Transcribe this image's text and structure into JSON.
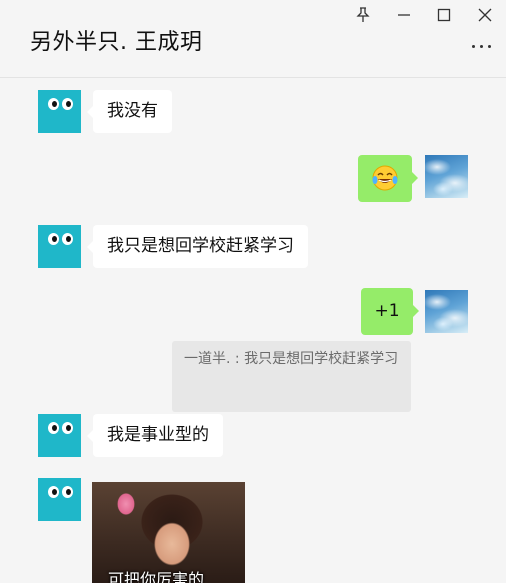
{
  "window": {
    "title": "另外半只. 王成玥",
    "controls": {
      "pin": "pin-icon",
      "minimize": "minimize-icon",
      "maximize": "maximize-icon",
      "close": "close-icon"
    },
    "more": "more-icon"
  },
  "messages": [
    {
      "side": "in",
      "text": "我没有"
    },
    {
      "side": "out",
      "emoji": "face-with-tears-of-joy"
    },
    {
      "side": "in",
      "text": "我只是想回学校赶紧学习"
    },
    {
      "side": "out",
      "text": "+1",
      "quote": "一道半. : 我只是想回学校赶紧学习"
    },
    {
      "side": "in",
      "text": "我是事业型的"
    },
    {
      "side": "in",
      "sticker_caption": "可把你厉害的"
    }
  ],
  "colors": {
    "out_bubble": "#95ec69",
    "in_bubble": "#ffffff",
    "bot_avatar": "#1fb7c9",
    "background": "#f5f5f5"
  }
}
